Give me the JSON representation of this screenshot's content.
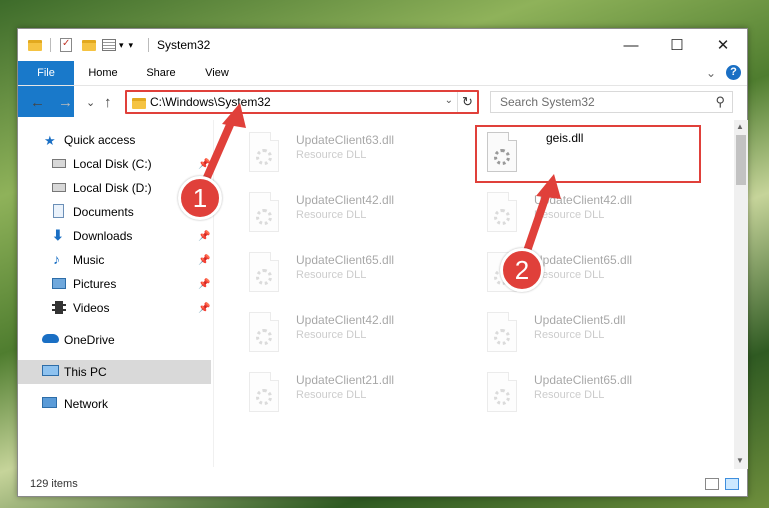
{
  "window": {
    "title": "System32",
    "min_glyph": "—",
    "max_glyph": "☐",
    "close_glyph": "✕"
  },
  "ribbon": {
    "tabs": [
      "File",
      "Home",
      "Share",
      "View"
    ],
    "collapse_glyph": "⌄",
    "help_glyph": "?"
  },
  "navigation": {
    "back_glyph": "←",
    "forward_glyph": "→",
    "recent_glyph": "⌄",
    "up_glyph": "↑",
    "address": "C:\\Windows\\System32",
    "address_dropdown_glyph": "⌄",
    "refresh_glyph": "↻",
    "search_placeholder": "Search System32",
    "search_glyph": "⚲"
  },
  "sidebar": {
    "items": [
      {
        "label": "Quick access",
        "icon": "star-icon",
        "pinned": false
      },
      {
        "label": "Local Disk (C:)",
        "icon": "drive-icon",
        "pinned": true
      },
      {
        "label": "Local Disk (D:)",
        "icon": "drive-icon",
        "pinned": false
      },
      {
        "label": "Documents",
        "icon": "documents-icon",
        "pinned": false
      },
      {
        "label": "Downloads",
        "icon": "download-icon",
        "pinned": true
      },
      {
        "label": "Music",
        "icon": "music-icon",
        "pinned": true
      },
      {
        "label": "Pictures",
        "icon": "pictures-icon",
        "pinned": true
      },
      {
        "label": "Videos",
        "icon": "videos-icon",
        "pinned": true
      },
      {
        "label": "OneDrive",
        "icon": "cloud-icon",
        "pinned": false
      },
      {
        "label": "This PC",
        "icon": "computer-icon",
        "pinned": false
      },
      {
        "label": "Network",
        "icon": "network-icon",
        "pinned": false
      }
    ],
    "pin_glyph": "📌"
  },
  "files": [
    {
      "name": "UpdateClient63.dll",
      "type": "Resource DLL"
    },
    {
      "name": "geis.dll",
      "type": ""
    },
    {
      "name": "UpdateClient42.dll",
      "type": "Resource DLL"
    },
    {
      "name": "UpdateClient42.dll",
      "type": "Resource DLL"
    },
    {
      "name": "UpdateClient65.dll",
      "type": "Resource DLL"
    },
    {
      "name": "UpdateClient65.dll",
      "type": "Resource DLL"
    },
    {
      "name": "UpdateClient42.dll",
      "type": "Resource DLL"
    },
    {
      "name": "UpdateClient5.dll",
      "type": "Resource DLL"
    },
    {
      "name": "UpdateClient21.dll",
      "type": "Resource DLL"
    },
    {
      "name": "UpdateClient65.dll",
      "type": "Resource DLL"
    }
  ],
  "status": {
    "item_count": "129 items"
  },
  "callouts": {
    "one": "1",
    "two": "2"
  },
  "colors": {
    "accent": "#1979ca",
    "callout": "#e0403a",
    "selection": "#cce8ff"
  }
}
